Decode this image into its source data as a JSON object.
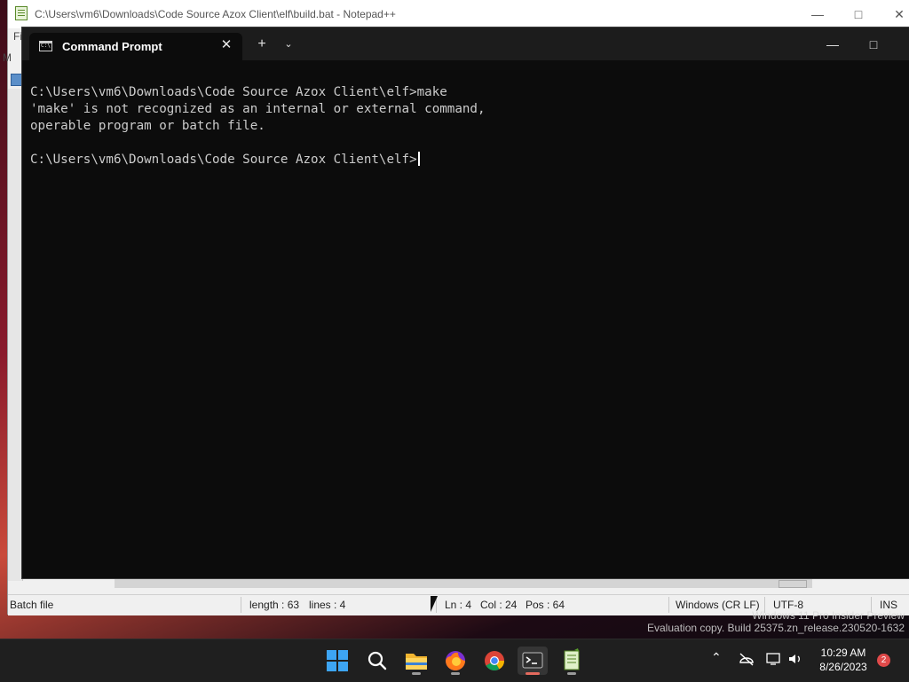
{
  "notepad": {
    "title": "C:\\Users\\vm6\\Downloads\\Code Source Azox Client\\elf\\build.bat - Notepad++",
    "menu_first": "Fi",
    "menu_second": "M",
    "status": {
      "type": "Batch file",
      "length": "length : 63",
      "lines": "lines : 4",
      "ln": "Ln : 4",
      "col": "Col : 24",
      "pos": "Pos : 64",
      "eol": "Windows (CR LF)",
      "encoding": "UTF-8",
      "mode": "INS"
    }
  },
  "terminal": {
    "tab_title": "Command Prompt",
    "lines": [
      "",
      "C:\\Users\\vm6\\Downloads\\Code Source Azox Client\\elf>make",
      "'make' is not recognized as an internal or external command,",
      "operable program or batch file.",
      "",
      "C:\\Users\\vm6\\Downloads\\Code Source Azox Client\\elf>"
    ]
  },
  "watermark": {
    "line1": "Windows 11 Pro Insider Preview",
    "line2": "Evaluation copy. Build 25375.zn_release.230520-1632"
  },
  "taskbar": {
    "apps": [
      {
        "name": "start",
        "icon": "windows-logo-icon"
      },
      {
        "name": "search",
        "icon": "search-icon"
      },
      {
        "name": "file-explorer",
        "icon": "folder-icon"
      },
      {
        "name": "firefox",
        "icon": "firefox-icon"
      },
      {
        "name": "chrome",
        "icon": "chrome-icon"
      },
      {
        "name": "terminal",
        "icon": "terminal-icon",
        "active": true
      },
      {
        "name": "notepad-plus-plus",
        "icon": "notepadpp-icon"
      }
    ],
    "time": "10:29 AM",
    "date": "8/26/2023",
    "notifications": "2"
  },
  "colors": {
    "terminal_bg": "#0c0c0c",
    "terminal_text": "#cccccc",
    "taskbar_bg": "#1f1f1f",
    "accent_active": "#e46a5e"
  }
}
